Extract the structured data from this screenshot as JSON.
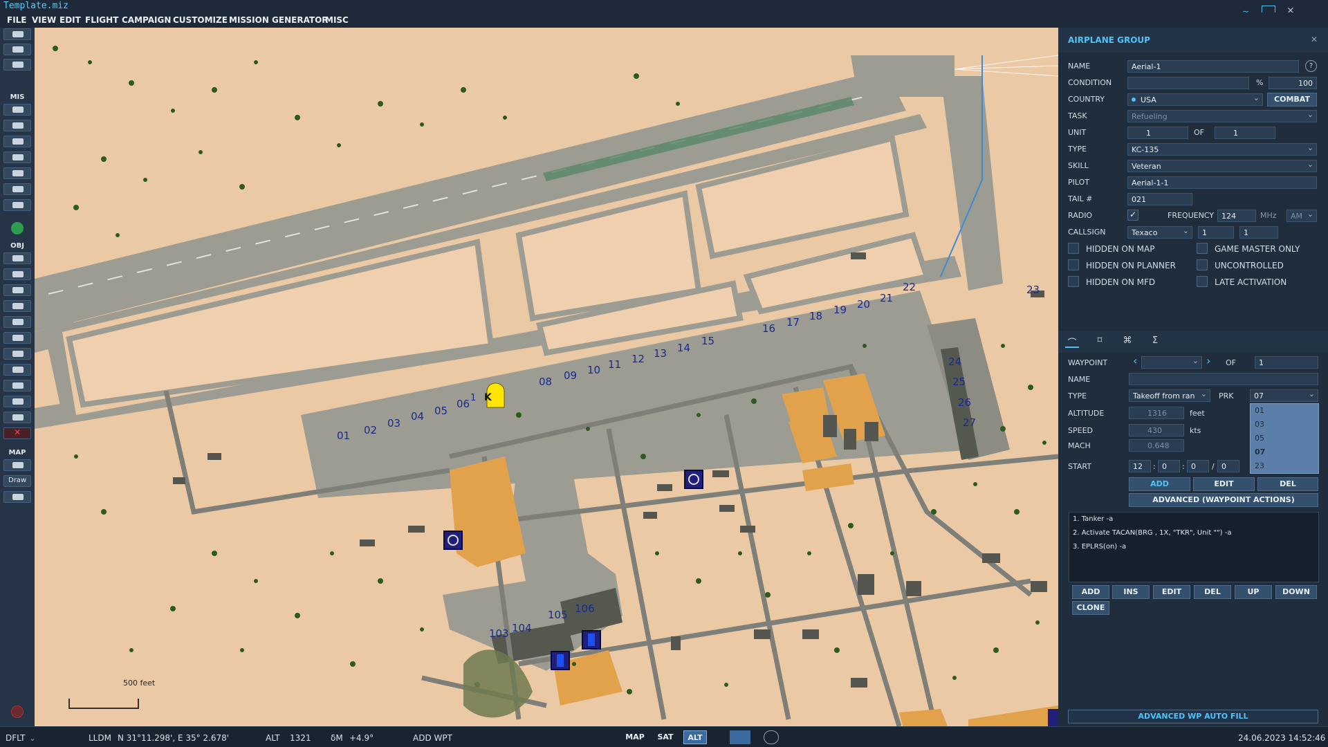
{
  "title": "Template.miz",
  "menu": [
    "FILE",
    "VIEW",
    "EDIT",
    "FLIGHT",
    "CAMPAIGN",
    "CUSTOMIZE",
    "MISSION GENERATOR",
    "MISC"
  ],
  "toolbar": {
    "section_mis": "MIS",
    "section_obj": "OBJ",
    "section_map": "MAP",
    "draw": "Draw"
  },
  "map": {
    "stands_row1": [
      "01",
      "02",
      "03",
      "04",
      "05",
      "06",
      "1"
    ],
    "stands_row2": [
      "08",
      "09",
      "10",
      "11",
      "12",
      "13",
      "14",
      "15",
      "16",
      "17",
      "18",
      "19",
      "20",
      "21",
      "22",
      "23"
    ],
    "stands_right": [
      "24",
      "25",
      "26",
      "27"
    ],
    "stands_bottom": [
      "103",
      "104",
      "105",
      "106"
    ],
    "marker_letter": "K",
    "scale_label": "500 feet"
  },
  "panel": {
    "title": "AIRPLANE GROUP",
    "name_label": "NAME",
    "name_value": "Aerial-1",
    "condition_label": "CONDITION",
    "condition_unit": "%",
    "condition_value": "100",
    "country_label": "COUNTRY",
    "country_value": "USA",
    "combat_button": "COMBAT",
    "task_label": "TASK",
    "task_value": "Refueling",
    "unit_label": "UNIT",
    "unit_value": "1",
    "unit_of": "OF",
    "unit_total": "1",
    "type_label": "TYPE",
    "type_value": "KC-135",
    "skill_label": "SKILL",
    "skill_value": "Veteran",
    "pilot_label": "PILOT",
    "pilot_value": "Aerial-1-1",
    "tail_label": "TAIL #",
    "tail_value": "021",
    "radio_label": "RADIO",
    "frequency_label": "FREQUENCY",
    "frequency_value": "124",
    "frequency_unit": "MHz",
    "modulation": "AM",
    "callsign_label": "CALLSIGN",
    "callsign_value": "Texaco",
    "callsign_n1": "1",
    "callsign_n2": "1",
    "checkboxes_left": [
      "HIDDEN ON MAP",
      "HIDDEN ON PLANNER",
      "HIDDEN ON MFD"
    ],
    "checkboxes_right": [
      "GAME MASTER ONLY",
      "UNCONTROLLED",
      "LATE ACTIVATION"
    ],
    "waypoint_label": "WAYPOINT",
    "waypoint_of": "OF",
    "waypoint_total": "1",
    "wp_name_label": "NAME",
    "wp_type_label": "TYPE",
    "wp_type_value": "Takeoff from ran",
    "prk_label": "PRK",
    "prk_value": "07",
    "prk_options": [
      "01",
      "03",
      "05",
      "07",
      "23"
    ],
    "altitude_label": "ALTITUDE",
    "altitude_value": "1316",
    "altitude_unit": "feet",
    "speed_label": "SPEED",
    "speed_value": "430",
    "speed_unit": "kts",
    "mach_label": "MACH",
    "mach_value": "0.648",
    "start_label": "START",
    "start_h": "12",
    "start_m": "0",
    "start_s": "0",
    "start_d": "0",
    "wp_buttons": [
      "ADD",
      "EDIT",
      "DEL"
    ],
    "advanced_button": "ADVANCED (WAYPOINT ACTIONS)",
    "actions": [
      "1. Tanker -a",
      "2. Activate TACAN(BRG , 1X, \"TKR\", Unit \"\")  -a",
      "3. EPLRS(on)  -a"
    ],
    "action_buttons": [
      "ADD",
      "INS",
      "EDIT",
      "DEL",
      "UP",
      "DOWN"
    ],
    "clone_button": "CLONE",
    "autofill_button": "ADVANCED WP AUTO FILL"
  },
  "status": {
    "profile": "DFLT",
    "coord_mode": "LLDM",
    "coords": "N 31°11.298', E 35° 2.678'",
    "alt_label": "ALT",
    "alt_value": "1321",
    "dm_label": "δM",
    "dm_value": "+4.9°",
    "add_wpt": "ADD WPT",
    "map_btn": "MAP",
    "sat_btn": "SAT",
    "alt_btn": "ALT",
    "datetime": "24.06.2023 14:52:46"
  },
  "colors": {
    "accent": "#4fc3f7",
    "sand": "#ecc9a5",
    "tarmac": "#9d9c92",
    "marker": "#ffe600"
  }
}
